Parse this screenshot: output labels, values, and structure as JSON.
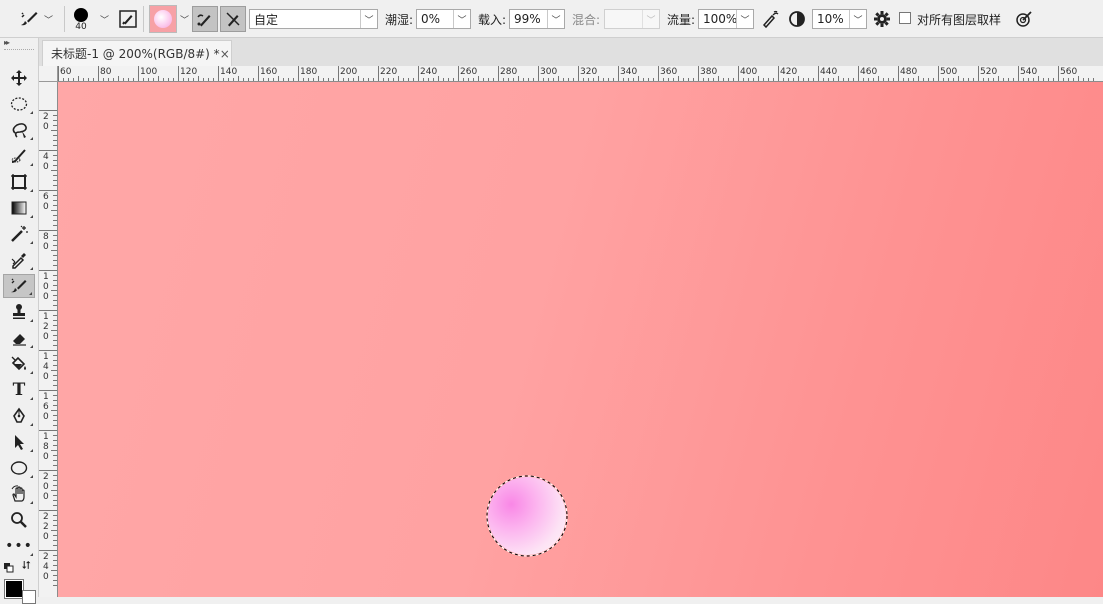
{
  "options_bar": {
    "brush_size": "40",
    "preset_value": "自定",
    "opacity_label": "潮湿:",
    "opacity_value": "0%",
    "load_label": "载入:",
    "load_value": "99%",
    "mix_label": "混合:",
    "mix_value": "",
    "flow_label": "流量:",
    "flow_value": "100%",
    "smoothing_value": "10%",
    "sample_all_label": "对所有图层取样",
    "sample_all_checked": false,
    "icons": [
      "mixer-brush-tool-icon",
      "brush-preset-icon",
      "brush-panel-toggle-icon",
      "current-color-swatch",
      "load-brush-icon",
      "clean-brush-icon",
      "airbrush-icon",
      "angle-icon",
      "settings-gear-icon",
      "pressure-size-icon"
    ]
  },
  "toolbar": {
    "tools": [
      "move-tool",
      "elliptical-marquee-tool",
      "lasso-tool",
      "quick-selection-tool",
      "crop-tool",
      "gradient-tool",
      "magic-wand-tool",
      "eyedropper-tool",
      "mixer-brush-tool",
      "clone-stamp-tool",
      "eraser-tool",
      "paint-bucket-tool",
      "type-tool",
      "pen-tool",
      "path-selection-tool",
      "ellipse-tool",
      "hand-rotate-tool",
      "zoom-tool",
      "more-tools"
    ],
    "active_tool": "mixer-brush-tool",
    "foreground_color": "#000000",
    "background_color": "#ffffff"
  },
  "document_tab": {
    "title": "未标题-1 @ 200%(RGB/8#) *",
    "close": "×"
  },
  "rulers": {
    "top_labels": [
      "60",
      "80",
      "100",
      "120",
      "140",
      "160",
      "180",
      "200",
      "220",
      "240",
      "260",
      "280",
      "300",
      "320",
      "340",
      "360",
      "380",
      "400",
      "420",
      "440",
      "460",
      "480",
      "500",
      "520",
      "540",
      "560"
    ],
    "left_labels": [
      "20",
      "40",
      "60",
      "80",
      "100",
      "120",
      "140",
      "160",
      "180",
      "200",
      "220",
      "240"
    ]
  },
  "canvas": {
    "gradient_colors": [
      "#ffa7a7",
      "#fd8787"
    ],
    "bubble_colors": [
      "#f987e6",
      "#fff4f7"
    ]
  }
}
